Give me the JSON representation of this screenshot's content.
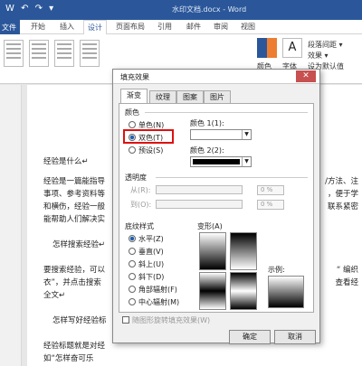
{
  "window": {
    "title": "水印文档.docx - Word",
    "quick_access": "W ↶ ↷ ▾"
  },
  "ribbon": {
    "tabs": [
      {
        "label": "文件"
      },
      {
        "label": "开始"
      },
      {
        "label": "插入"
      },
      {
        "label": "设计"
      },
      {
        "label": "页面布局"
      },
      {
        "label": "引用"
      },
      {
        "label": "邮件"
      },
      {
        "label": "审阅"
      },
      {
        "label": "视图"
      }
    ],
    "right": {
      "color_label": "颜色",
      "font_label": "字体",
      "spacing_label": "段落间距 ▾",
      "effects_label": "效果 ▾",
      "default_label": "设为默认值"
    }
  },
  "document": {
    "lines": [
      "经验是什么↵",
      "经验是一篇能指导",
      "事项、参考资料等",
      "和横伤，经验一般",
      "能帮助人们解决实",
      "怎样搜索经验↵",
      "要搜索经验，可以",
      "衣”，并点击搜索",
      "全文↵",
      "怎样写好经验标",
      "经验标题就是对经",
      "如“怎样奋可乐"
    ],
    "right_lines": [
      "/方法、注",
      "，便于学",
      "联系紧密",
      "“ 编织",
      "查看经"
    ]
  },
  "dialog": {
    "title": "填充效果",
    "close": "✕",
    "tabs": [
      {
        "label": "渐变"
      },
      {
        "label": "纹理"
      },
      {
        "label": "图案"
      },
      {
        "label": "图片"
      }
    ],
    "colors": {
      "group": "颜色",
      "options": [
        {
          "label": "单色(N)"
        },
        {
          "label": "双色(T)"
        },
        {
          "label": "预设(S)"
        }
      ],
      "color1_label": "颜色 1(1):",
      "color2_label": "颜色 2(2):",
      "color1": "#ffffff",
      "color2": "#000000"
    },
    "transparency": {
      "group": "透明度",
      "from_label": "从(R):",
      "to_label": "到(O):",
      "from_value": "0 %",
      "to_value": "0 %"
    },
    "shading": {
      "group": "底纹样式",
      "options": [
        {
          "label": "水平(Z)"
        },
        {
          "label": "垂直(V)"
        },
        {
          "label": "斜上(U)"
        },
        {
          "label": "斜下(D)"
        },
        {
          "label": "角部辐射(F)"
        },
        {
          "label": "中心辐射(M)"
        }
      ]
    },
    "variants_label": "变形(A)",
    "sample_label": "示例:",
    "rotate_checkbox": "随图形旋转填充效果(W)",
    "ok": "确定",
    "cancel": "取消"
  }
}
